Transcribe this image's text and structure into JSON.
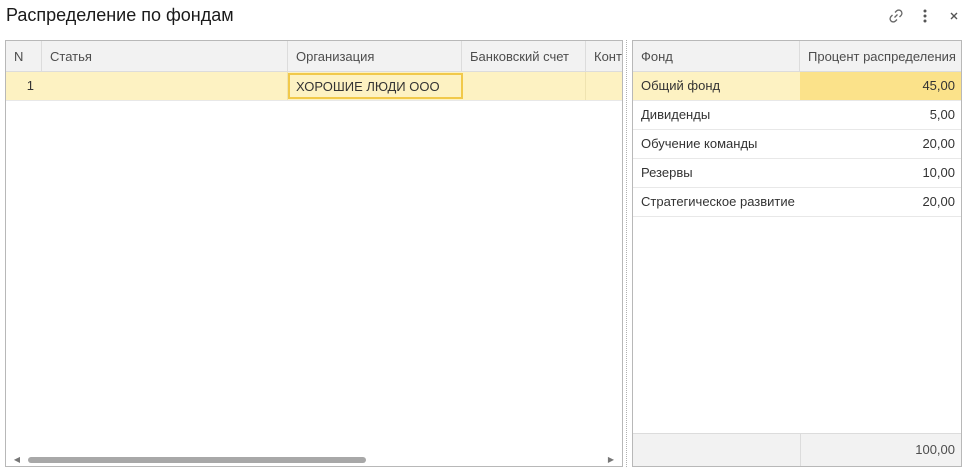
{
  "window": {
    "title": "Распределение по фондам"
  },
  "left_table": {
    "columns": [
      "N",
      "Статья",
      "Организация",
      "Банковский счет",
      "Конт"
    ],
    "rows": [
      {
        "n": "1",
        "statya": "",
        "organization": "ХОРОШИЕ ЛЮДИ ООО",
        "bank_account": "",
        "kont": ""
      }
    ]
  },
  "right_table": {
    "columns": [
      "Фонд",
      "Процент распределения"
    ],
    "rows": [
      {
        "fund": "Общий фонд",
        "percent": "45,00"
      },
      {
        "fund": "Дивиденды",
        "percent": "5,00"
      },
      {
        "fund": "Обучение команды",
        "percent": "20,00"
      },
      {
        "fund": "Резервы",
        "percent": "10,00"
      },
      {
        "fund": "Стратегическое развитие",
        "percent": "20,00"
      }
    ],
    "total": "100,00"
  },
  "icons": {
    "link": "link-icon",
    "more": "more-vertical-icon",
    "close": "close-icon"
  },
  "colors": {
    "selected_row": "#fdf2c2",
    "selected_cell": "#fbe28a",
    "input_border": "#f1c94a"
  }
}
